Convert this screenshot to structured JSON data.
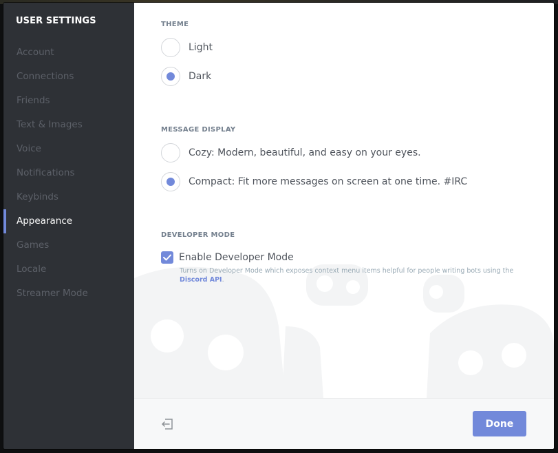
{
  "sidebar": {
    "title": "USER SETTINGS",
    "items": [
      {
        "label": "Account"
      },
      {
        "label": "Connections"
      },
      {
        "label": "Friends"
      },
      {
        "label": "Text & Images"
      },
      {
        "label": "Voice"
      },
      {
        "label": "Notifications"
      },
      {
        "label": "Keybinds"
      },
      {
        "label": "Appearance",
        "active": true
      },
      {
        "label": "Games"
      },
      {
        "label": "Locale"
      },
      {
        "label": "Streamer Mode"
      }
    ]
  },
  "theme": {
    "label": "THEME",
    "options": [
      {
        "label": "Light",
        "selected": false
      },
      {
        "label": "Dark",
        "selected": true
      }
    ]
  },
  "message_display": {
    "label": "MESSAGE DISPLAY",
    "options": [
      {
        "label": "Cozy: Modern, beautiful, and easy on your eyes.",
        "selected": false
      },
      {
        "label": "Compact: Fit more messages on screen at one time. #IRC",
        "selected": true
      }
    ]
  },
  "developer_mode": {
    "label": "DEVELOPER MODE",
    "checkbox_label": "Enable Developer Mode",
    "checked": true,
    "description": "Turns on Developer Mode which exposes context menu items helpful for people writing bots using the",
    "link_text": "Discord API",
    "description_end": "."
  },
  "footer": {
    "done_label": "Done",
    "exit_icon": "logout-arrow-icon"
  },
  "colors": {
    "accent": "#7289da",
    "sidebar_bg": "#2e3136",
    "sidebar_text": "#5c6068",
    "content_bg": "#ffffff"
  }
}
